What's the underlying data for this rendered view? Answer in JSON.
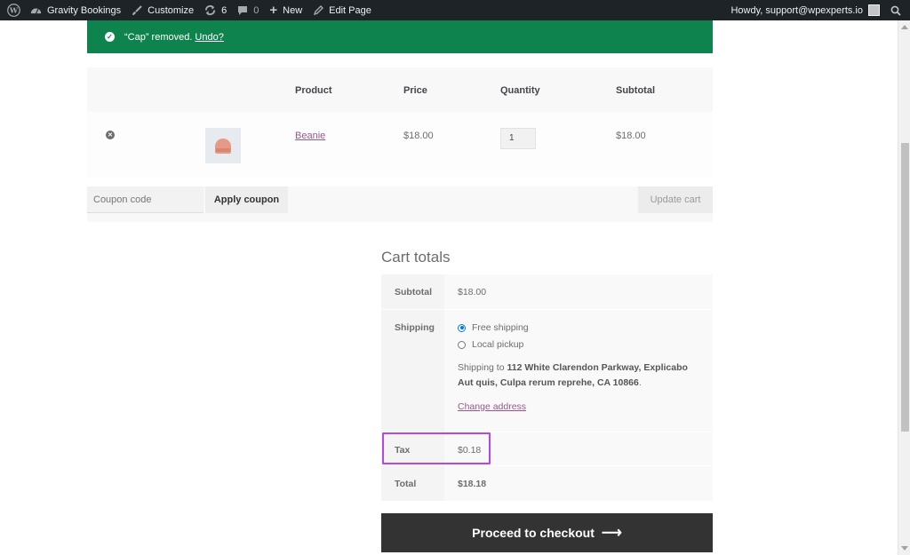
{
  "adminbar": {
    "wp_icon": "wordpress-logo-icon",
    "site_name": "Gravity Bookings",
    "customize": "Customize",
    "updates_count": "6",
    "comments_count": "0",
    "new_label": "New",
    "edit_page": "Edit Page",
    "howdy": "Howdy, support@wpexperts.io"
  },
  "notice": {
    "text": "“Cap” removed.",
    "undo": "Undo?",
    "color": "#0f834d"
  },
  "cart": {
    "headers": {
      "product": "Product",
      "price": "Price",
      "quantity": "Quantity",
      "subtotal": "Subtotal"
    },
    "items": [
      {
        "product": "Beanie",
        "price": "$18.00",
        "quantity": "1",
        "subtotal": "$18.00"
      }
    ],
    "coupon_placeholder": "Coupon code",
    "apply_coupon": "Apply coupon",
    "update_cart": "Update cart"
  },
  "totals": {
    "title": "Cart totals",
    "subtotal_label": "Subtotal",
    "subtotal_value": "$18.00",
    "shipping_label": "Shipping",
    "shipping_options": [
      "Free shipping",
      "Local pickup"
    ],
    "shipping_to_prefix": "Shipping to ",
    "shipping_address": "112 White Clarendon Parkway, Explicabo Aut quis, Culpa rerum reprehe, CA 10866",
    "shipping_to_suffix": ".",
    "change_address": "Change address",
    "tax_label": "Tax",
    "tax_value": "$0.18",
    "total_label": "Total",
    "total_value": "$18.18",
    "highlight_color": "#b745e8"
  },
  "checkout": {
    "label": "Proceed to checkout",
    "arrow": "⟶"
  }
}
